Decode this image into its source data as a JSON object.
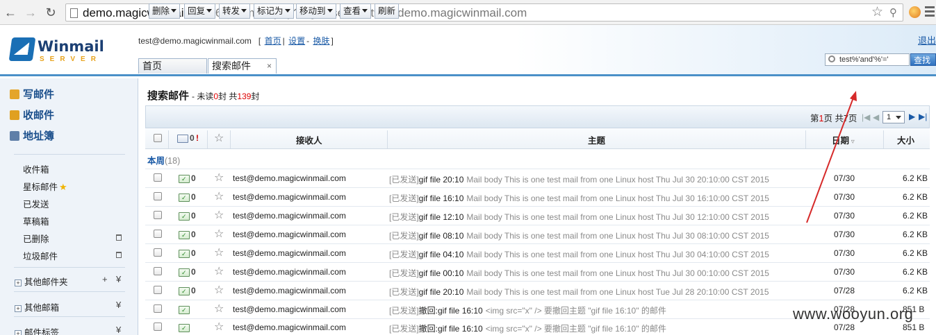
{
  "browser": {
    "url_host": "demo.magicwinmail.com",
    "url_rest": ":6080/main.php?loginuser=test%40demo.magicwinmail.com"
  },
  "header": {
    "logo_title": "Winmail",
    "logo_sub": "SERVER",
    "user_email": "test@demo.magicwinmail.com",
    "links": [
      "首页",
      "设置",
      "换肤"
    ],
    "logout": "退出",
    "tabs": [
      "首页",
      "搜索邮件"
    ],
    "search_value": "test%'and'%'='",
    "search_button": "查找"
  },
  "sidebar": {
    "actions": [
      "写邮件",
      "收邮件",
      "地址簿"
    ],
    "folders": [
      "收件箱",
      "星标邮件",
      "已发送",
      "草稿箱",
      "已删除",
      "垃圾邮件"
    ],
    "groups": [
      "其他邮件夹",
      "其他邮箱",
      "邮件标签"
    ]
  },
  "main": {
    "title": "搜索邮件",
    "unread_label": "- 未读",
    "unread_count": "0",
    "total_label": "封 共",
    "total_count": "139",
    "unit": "封",
    "toolbar": [
      "删除",
      "回复",
      "转发",
      "标记为",
      "移动到",
      "查看",
      "刷新"
    ],
    "pager": {
      "prefix": "第",
      "current": "1",
      "mid": "页 共",
      "total": "7",
      "suffix": "页",
      "select_value": "1"
    },
    "columns": {
      "recipient": "接收人",
      "subject": "主题",
      "date": "日期",
      "size": "大小"
    },
    "group_label": "本周",
    "group_count": "(18)",
    "rows": [
      {
        "to": "test@demo.magicwinmail.com",
        "tag": "[已发送]",
        "subject": "gif file 20:10",
        "preview": "Mail body This is one test mail from one Linux host Thu Jul 30 20:10:00 CST 2015",
        "date": "07/30",
        "size": "6.2 KB"
      },
      {
        "to": "test@demo.magicwinmail.com",
        "tag": "[已发送]",
        "subject": "gif file 16:10",
        "preview": "Mail body This is one test mail from one Linux host Thu Jul 30 16:10:00 CST 2015",
        "date": "07/30",
        "size": "6.2 KB"
      },
      {
        "to": "test@demo.magicwinmail.com",
        "tag": "[已发送]",
        "subject": "gif file 12:10",
        "preview": "Mail body This is one test mail from one Linux host Thu Jul 30 12:10:00 CST 2015",
        "date": "07/30",
        "size": "6.2 KB"
      },
      {
        "to": "test@demo.magicwinmail.com",
        "tag": "[已发送]",
        "subject": "gif file 08:10",
        "preview": "Mail body This is one test mail from one Linux host Thu Jul 30 08:10:00 CST 2015",
        "date": "07/30",
        "size": "6.2 KB"
      },
      {
        "to": "test@demo.magicwinmail.com",
        "tag": "[已发送]",
        "subject": "gif file 04:10",
        "preview": "Mail body This is one test mail from one Linux host Thu Jul 30 04:10:00 CST 2015",
        "date": "07/30",
        "size": "6.2 KB"
      },
      {
        "to": "test@demo.magicwinmail.com",
        "tag": "[已发送]",
        "subject": "gif file 00:10",
        "preview": "Mail body This is one test mail from one Linux host Thu Jul 30 00:10:00 CST 2015",
        "date": "07/30",
        "size": "6.2 KB"
      },
      {
        "to": "test@demo.magicwinmail.com",
        "tag": "[已发送]",
        "subject": "gif file 20:10",
        "preview": "Mail body This is one test mail from one Linux host Tue Jul 28 20:10:00 CST 2015",
        "date": "07/28",
        "size": "6.2 KB"
      },
      {
        "to": "test@demo.magicwinmail.com",
        "tag": "[已发送]",
        "subject": "撤回:gif file 16:10",
        "preview": "<img src=\"x\" /> 要撤回主题 \"gif file 16:10\" 的邮件",
        "date": "07/28",
        "size": "851 B"
      },
      {
        "to": "test@demo.magicwinmail.com",
        "tag": "[已发送]",
        "subject": "撤回:gif file 16:10",
        "preview": "<img src=\"x\" /> 要撤回主题 \"gif file 16:10\" 的邮件",
        "date": "07/28",
        "size": "851 B"
      }
    ]
  },
  "watermark": "www.wooyun.org",
  "colors": {
    "accent": "#1a5aa6",
    "annotation_arrow": "#d62a2a",
    "header_border": "#4a90c8"
  }
}
